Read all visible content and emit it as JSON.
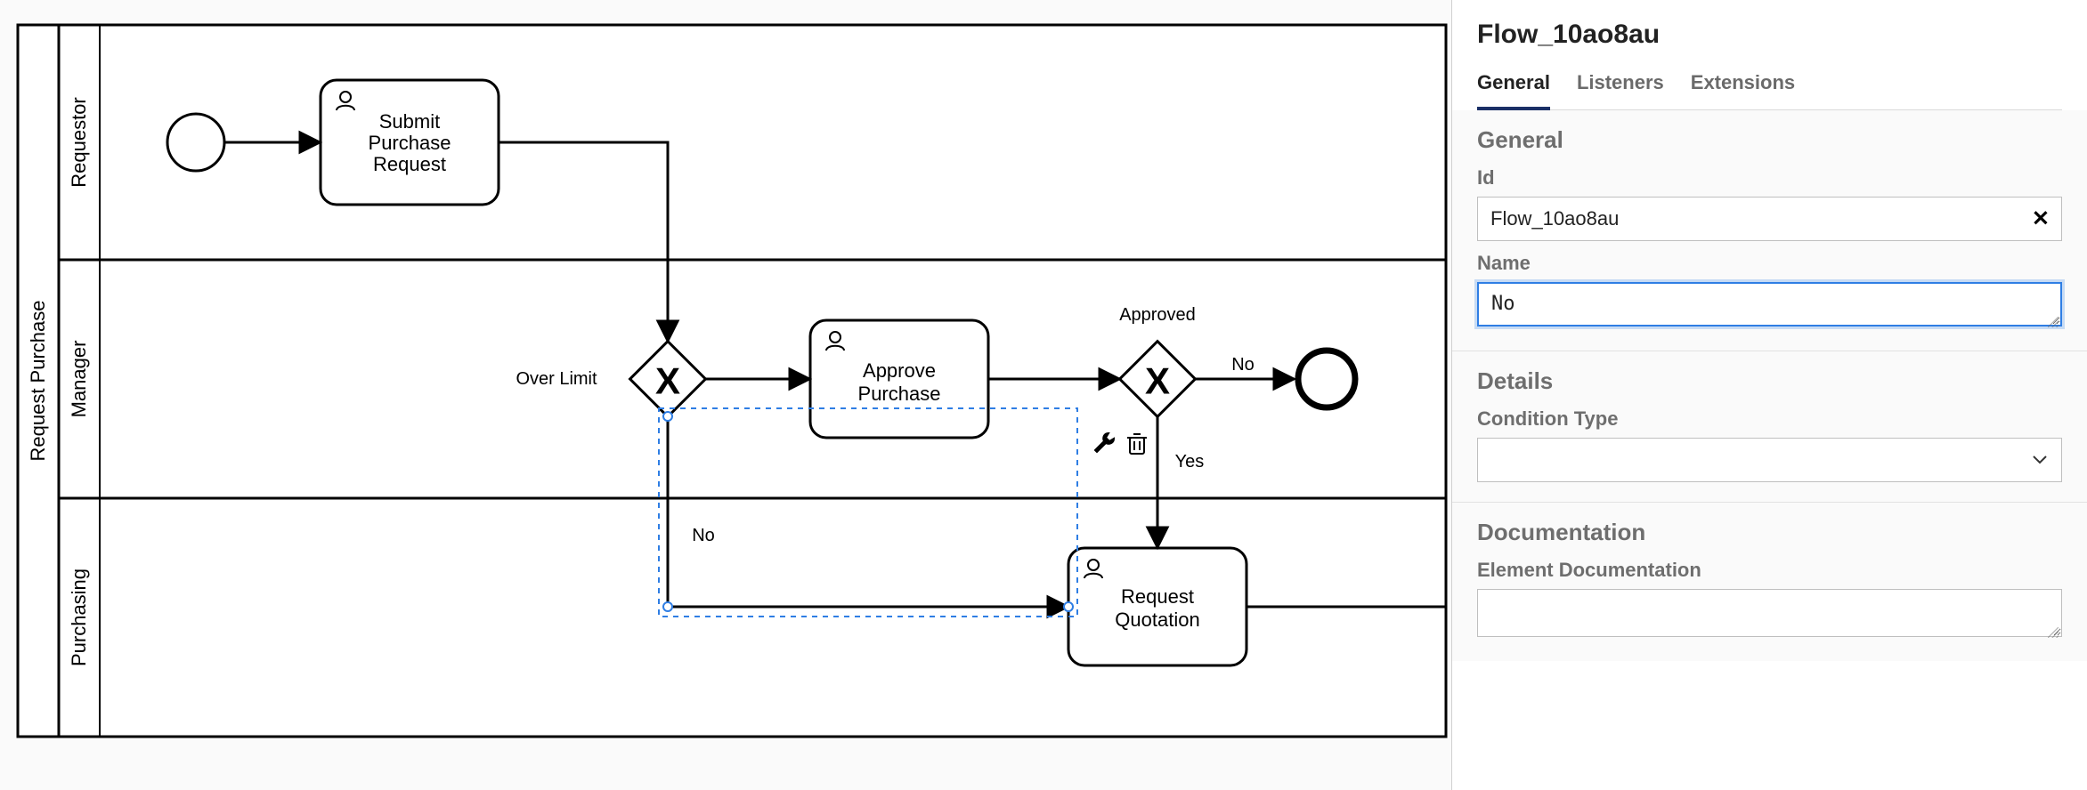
{
  "diagram": {
    "pool": {
      "label": "Request Purchase"
    },
    "lanes": [
      {
        "id": "requestor",
        "label": "Requestor"
      },
      {
        "id": "manager",
        "label": "Manager"
      },
      {
        "id": "purchasing",
        "label": "Purchasing"
      }
    ],
    "tasks": {
      "submit": {
        "line1": "Submit",
        "line2": "Purchase",
        "line3": "Request"
      },
      "approve": {
        "line1": "Approve",
        "line2": "Purchase"
      },
      "quote": {
        "line1": "Request",
        "line2": "Quotation"
      }
    },
    "gateways": {
      "overlimit": {
        "label": "Over Limit"
      },
      "approved": {
        "label": "Approved"
      }
    },
    "edgeLabels": {
      "overlimit_no": "No",
      "approved_no": "No",
      "approved_yes": "Yes"
    },
    "selection": {
      "element": "Flow_10ao8au (over-limit → quotation, label No)"
    }
  },
  "panel": {
    "title": "Flow_10ao8au",
    "tabs": [
      {
        "id": "general",
        "label": "General"
      },
      {
        "id": "listeners",
        "label": "Listeners"
      },
      {
        "id": "extensions",
        "label": "Extensions"
      }
    ],
    "activeTab": "general",
    "sections": {
      "general": {
        "title": "General",
        "fields": {
          "id": {
            "label": "Id",
            "value": "Flow_10ao8au"
          },
          "name": {
            "label": "Name",
            "value": "No"
          }
        }
      },
      "details": {
        "title": "Details",
        "fields": {
          "conditionType": {
            "label": "Condition Type",
            "value": ""
          }
        }
      },
      "documentation": {
        "title": "Documentation",
        "fields": {
          "elementDoc": {
            "label": "Element Documentation",
            "value": ""
          }
        }
      }
    }
  }
}
